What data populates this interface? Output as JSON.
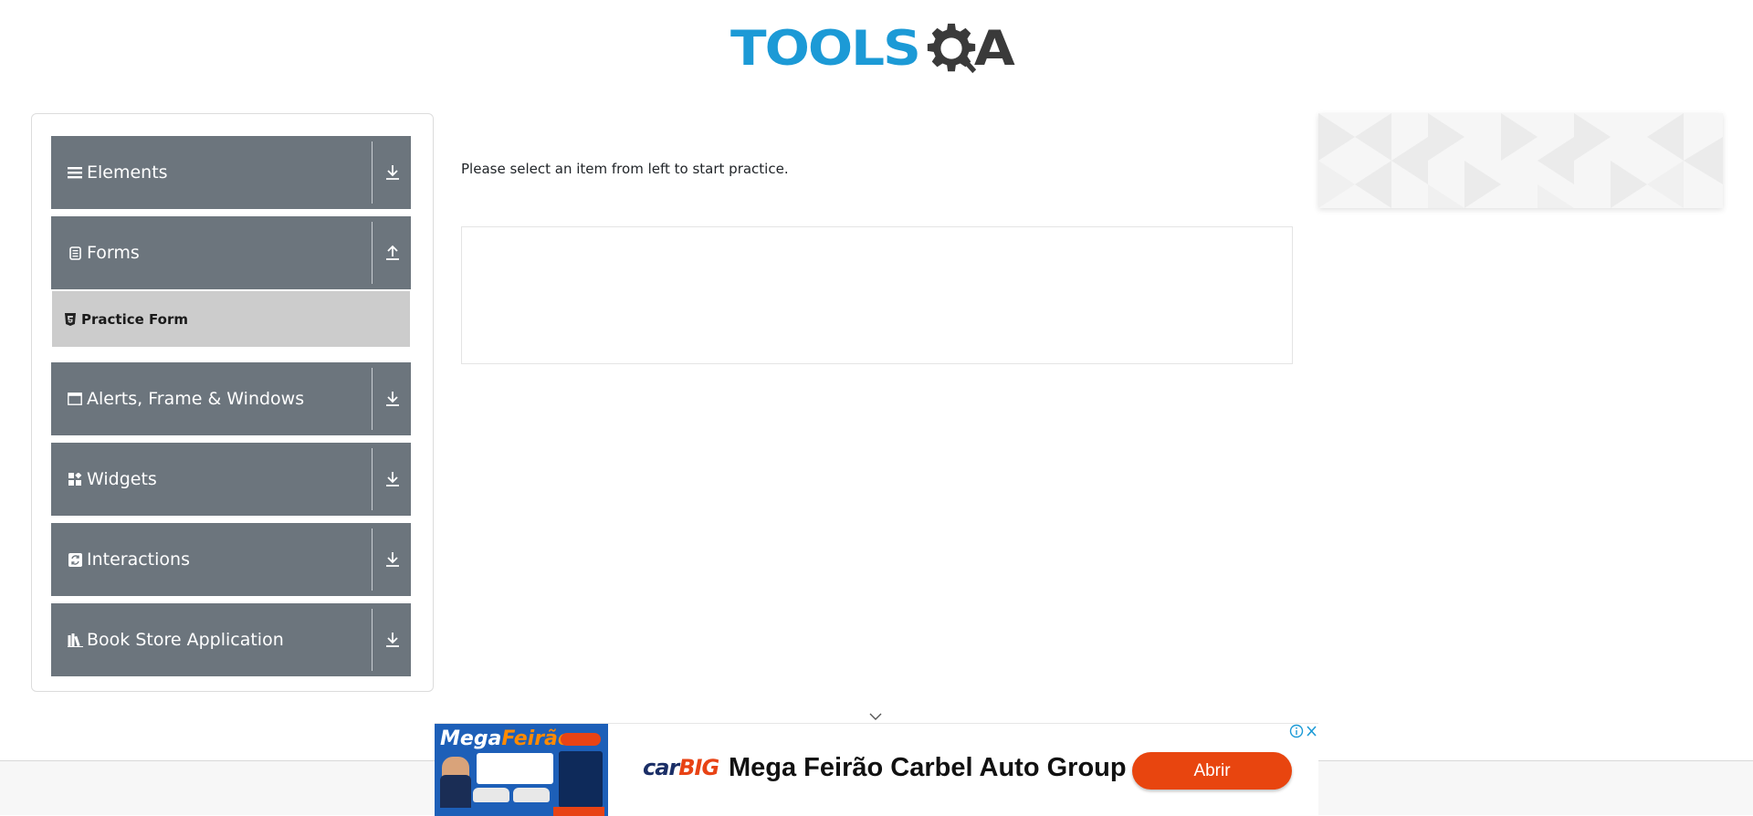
{
  "header": {
    "logo_text_primary": "TOOLS",
    "logo_text_secondary": "A",
    "logo_primary_color": "#1c9ad6",
    "logo_secondary_color": "#3a3a3a"
  },
  "sidebar": {
    "groups": [
      {
        "label": "Elements",
        "icon": "hamburger-icon",
        "arrow": "download-arrow-icon",
        "expanded": false
      },
      {
        "label": "Forms",
        "icon": "document-icon",
        "arrow": "upload-arrow-icon",
        "expanded": true,
        "items": [
          {
            "label": "Practice Form",
            "icon": "html5-icon",
            "selected": true
          }
        ]
      },
      {
        "label": "Alerts, Frame & Windows",
        "icon": "window-icon",
        "arrow": "download-arrow-icon",
        "expanded": false
      },
      {
        "label": "Widgets",
        "icon": "widgets-icon",
        "arrow": "download-arrow-icon",
        "expanded": false
      },
      {
        "label": "Interactions",
        "icon": "sync-icon",
        "arrow": "download-arrow-icon",
        "expanded": false
      },
      {
        "label": "Book Store Application",
        "icon": "books-icon",
        "arrow": "download-arrow-icon",
        "expanded": false
      }
    ],
    "header_bg": "#6c757d",
    "selected_bg": "#cccccc"
  },
  "main": {
    "message": "Please select an item from left to start practice."
  },
  "bottom_ad": {
    "thumb_title_a": "Mega",
    "thumb_title_b": "Feirão",
    "brand_a": "car",
    "brand_b": "BIG",
    "title": "Mega Feirão Carbel Auto Group",
    "button_label": "Abrir",
    "button_color": "#e8450f"
  }
}
